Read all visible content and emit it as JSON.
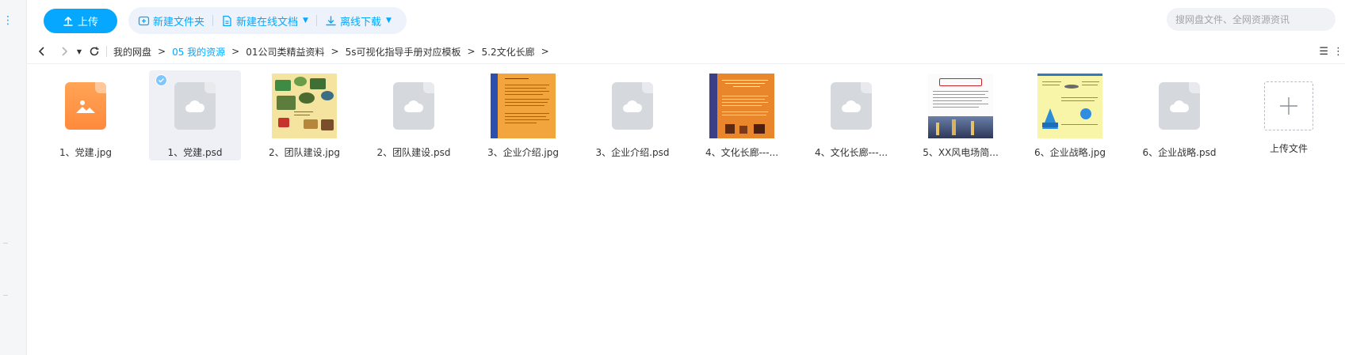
{
  "toolbar": {
    "upload_label": "上传",
    "new_folder_label": "新建文件夹",
    "new_online_doc_label": "新建在线文档",
    "offline_download_label": "离线下载"
  },
  "search": {
    "placeholder": "搜网盘文件、全网资源资讯"
  },
  "breadcrumb": {
    "items": [
      "我的网盘",
      "05 我的资源",
      "01公司类精益资料",
      "5s可视化指导手册对应模板",
      "5.2文化长廊"
    ],
    "active_index": 1
  },
  "files": [
    {
      "name": "1、党建.jpg",
      "kind": "image-icon"
    },
    {
      "name": "1、党建.psd",
      "kind": "psd",
      "selected": true
    },
    {
      "name": "2、团队建设.jpg",
      "kind": "photo-team"
    },
    {
      "name": "2、团队建设.psd",
      "kind": "psd"
    },
    {
      "name": "3、企业介绍.jpg",
      "kind": "photo-intro"
    },
    {
      "name": "3、企业介绍.psd",
      "kind": "psd"
    },
    {
      "name": "4、文化长廊---...",
      "kind": "photo-corridor"
    },
    {
      "name": "4、文化长廊---...",
      "kind": "psd"
    },
    {
      "name": "5、XX风电场简...",
      "kind": "photo-wind"
    },
    {
      "name": "6、企业战略.jpg",
      "kind": "photo-strategy"
    },
    {
      "name": "6、企业战略.psd",
      "kind": "psd"
    }
  ],
  "upload_tile_label": "上传文件",
  "colors": {
    "accent": "#06a7ff",
    "psd_gray": "#d5d8dd",
    "image_orange": "#ff8a3c"
  }
}
